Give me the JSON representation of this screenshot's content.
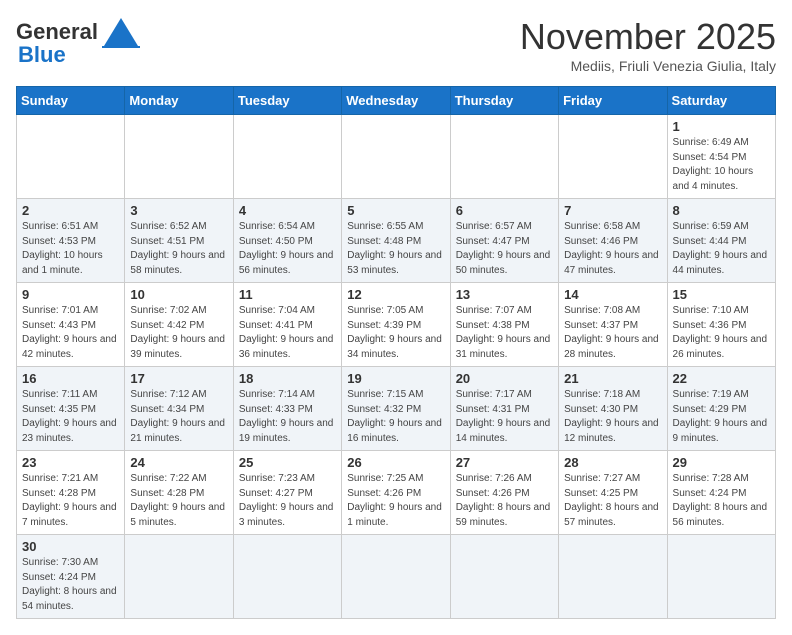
{
  "header": {
    "logo_general": "General",
    "logo_blue": "Blue",
    "title": "November 2025",
    "subtitle": "Mediis, Friuli Venezia Giulia, Italy"
  },
  "days": [
    "Sunday",
    "Monday",
    "Tuesday",
    "Wednesday",
    "Thursday",
    "Friday",
    "Saturday"
  ],
  "weeks": [
    [
      {
        "date": "",
        "info": ""
      },
      {
        "date": "",
        "info": ""
      },
      {
        "date": "",
        "info": ""
      },
      {
        "date": "",
        "info": ""
      },
      {
        "date": "",
        "info": ""
      },
      {
        "date": "",
        "info": ""
      },
      {
        "date": "1",
        "info": "Sunrise: 6:49 AM\nSunset: 4:54 PM\nDaylight: 10 hours and 4 minutes."
      }
    ],
    [
      {
        "date": "2",
        "info": "Sunrise: 6:51 AM\nSunset: 4:53 PM\nDaylight: 10 hours and 1 minute."
      },
      {
        "date": "3",
        "info": "Sunrise: 6:52 AM\nSunset: 4:51 PM\nDaylight: 9 hours and 58 minutes."
      },
      {
        "date": "4",
        "info": "Sunrise: 6:54 AM\nSunset: 4:50 PM\nDaylight: 9 hours and 56 minutes."
      },
      {
        "date": "5",
        "info": "Sunrise: 6:55 AM\nSunset: 4:48 PM\nDaylight: 9 hours and 53 minutes."
      },
      {
        "date": "6",
        "info": "Sunrise: 6:57 AM\nSunset: 4:47 PM\nDaylight: 9 hours and 50 minutes."
      },
      {
        "date": "7",
        "info": "Sunrise: 6:58 AM\nSunset: 4:46 PM\nDaylight: 9 hours and 47 minutes."
      },
      {
        "date": "8",
        "info": "Sunrise: 6:59 AM\nSunset: 4:44 PM\nDaylight: 9 hours and 44 minutes."
      }
    ],
    [
      {
        "date": "9",
        "info": "Sunrise: 7:01 AM\nSunset: 4:43 PM\nDaylight: 9 hours and 42 minutes."
      },
      {
        "date": "10",
        "info": "Sunrise: 7:02 AM\nSunset: 4:42 PM\nDaylight: 9 hours and 39 minutes."
      },
      {
        "date": "11",
        "info": "Sunrise: 7:04 AM\nSunset: 4:41 PM\nDaylight: 9 hours and 36 minutes."
      },
      {
        "date": "12",
        "info": "Sunrise: 7:05 AM\nSunset: 4:39 PM\nDaylight: 9 hours and 34 minutes."
      },
      {
        "date": "13",
        "info": "Sunrise: 7:07 AM\nSunset: 4:38 PM\nDaylight: 9 hours and 31 minutes."
      },
      {
        "date": "14",
        "info": "Sunrise: 7:08 AM\nSunset: 4:37 PM\nDaylight: 9 hours and 28 minutes."
      },
      {
        "date": "15",
        "info": "Sunrise: 7:10 AM\nSunset: 4:36 PM\nDaylight: 9 hours and 26 minutes."
      }
    ],
    [
      {
        "date": "16",
        "info": "Sunrise: 7:11 AM\nSunset: 4:35 PM\nDaylight: 9 hours and 23 minutes."
      },
      {
        "date": "17",
        "info": "Sunrise: 7:12 AM\nSunset: 4:34 PM\nDaylight: 9 hours and 21 minutes."
      },
      {
        "date": "18",
        "info": "Sunrise: 7:14 AM\nSunset: 4:33 PM\nDaylight: 9 hours and 19 minutes."
      },
      {
        "date": "19",
        "info": "Sunrise: 7:15 AM\nSunset: 4:32 PM\nDaylight: 9 hours and 16 minutes."
      },
      {
        "date": "20",
        "info": "Sunrise: 7:17 AM\nSunset: 4:31 PM\nDaylight: 9 hours and 14 minutes."
      },
      {
        "date": "21",
        "info": "Sunrise: 7:18 AM\nSunset: 4:30 PM\nDaylight: 9 hours and 12 minutes."
      },
      {
        "date": "22",
        "info": "Sunrise: 7:19 AM\nSunset: 4:29 PM\nDaylight: 9 hours and 9 minutes."
      }
    ],
    [
      {
        "date": "23",
        "info": "Sunrise: 7:21 AM\nSunset: 4:28 PM\nDaylight: 9 hours and 7 minutes."
      },
      {
        "date": "24",
        "info": "Sunrise: 7:22 AM\nSunset: 4:28 PM\nDaylight: 9 hours and 5 minutes."
      },
      {
        "date": "25",
        "info": "Sunrise: 7:23 AM\nSunset: 4:27 PM\nDaylight: 9 hours and 3 minutes."
      },
      {
        "date": "26",
        "info": "Sunrise: 7:25 AM\nSunset: 4:26 PM\nDaylight: 9 hours and 1 minute."
      },
      {
        "date": "27",
        "info": "Sunrise: 7:26 AM\nSunset: 4:26 PM\nDaylight: 8 hours and 59 minutes."
      },
      {
        "date": "28",
        "info": "Sunrise: 7:27 AM\nSunset: 4:25 PM\nDaylight: 8 hours and 57 minutes."
      },
      {
        "date": "29",
        "info": "Sunrise: 7:28 AM\nSunset: 4:24 PM\nDaylight: 8 hours and 56 minutes."
      }
    ],
    [
      {
        "date": "30",
        "info": "Sunrise: 7:30 AM\nSunset: 4:24 PM\nDaylight: 8 hours and 54 minutes."
      },
      {
        "date": "",
        "info": ""
      },
      {
        "date": "",
        "info": ""
      },
      {
        "date": "",
        "info": ""
      },
      {
        "date": "",
        "info": ""
      },
      {
        "date": "",
        "info": ""
      },
      {
        "date": "",
        "info": ""
      }
    ]
  ]
}
